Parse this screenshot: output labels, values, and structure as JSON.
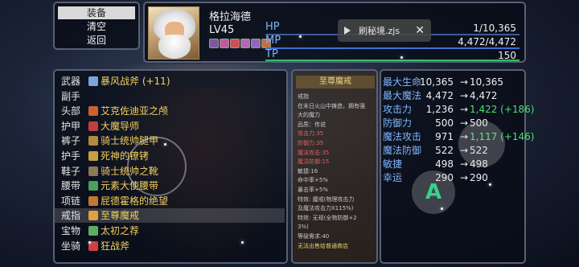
{
  "menu": {
    "items": [
      {
        "label": "装备",
        "active": true
      },
      {
        "label": "清空",
        "active": false
      },
      {
        "label": "返回",
        "active": false
      }
    ]
  },
  "character": {
    "name": "格拉海德",
    "level": "LV45",
    "buffs": [
      "buff-1",
      "buff-2",
      "buff-3",
      "buff-4",
      "buff-5",
      "buff-6"
    ],
    "bars": [
      {
        "label": "HP",
        "value": "1/10,365",
        "color": "#3e5a9e",
        "fill": 0.0001
      },
      {
        "label": "MP",
        "value": "4,472/4,472",
        "color": "#3f6fd6",
        "fill": 1
      },
      {
        "label": "TP",
        "value": "150",
        "color": "#2fbf6a",
        "fill": 1
      }
    ]
  },
  "toast": {
    "text": "刷秘境.zjs",
    "close": "✕"
  },
  "equipment": [
    {
      "slot": "武器",
      "name": "暴风战斧 (+11)",
      "icon_color": "#7aa6e0"
    },
    {
      "slot": "副手",
      "name": "",
      "icon_color": ""
    },
    {
      "slot": "头部",
      "name": "艾克佐迪亚之颅",
      "icon_color": "#d06030"
    },
    {
      "slot": "护甲",
      "name": "大魔导师",
      "icon_color": "#c04040"
    },
    {
      "slot": "裤子",
      "name": "骑士统帅腿甲",
      "icon_color": "#b08a40"
    },
    {
      "slot": "护手",
      "name": "死神的镣铐",
      "icon_color": "#c8a040"
    },
    {
      "slot": "鞋子",
      "name": "骑士统帅之靴",
      "icon_color": "#8a7a55"
    },
    {
      "slot": "腰带",
      "name": "元素大使腰带",
      "icon_color": "#4aa060"
    },
    {
      "slot": "项链",
      "name": "屁德霍格的绝望",
      "icon_color": "#c07a30"
    },
    {
      "slot": "戒指",
      "name": "至尊魔戒",
      "icon_color": "#e0a040"
    },
    {
      "slot": "宝物",
      "name": "太初之荐",
      "icon_color": "#5ab060"
    },
    {
      "slot": "坐骑",
      "name": "狂战斧",
      "icon_color": "#d04040"
    }
  ],
  "detail": {
    "title": "至尊魔戒",
    "lines": [
      {
        "text": "戒指",
        "style": "grey"
      },
      {
        "text": "在末日火山中铸造，拥有强",
        "style": "grey"
      },
      {
        "text": "大的魔力",
        "style": "grey"
      },
      {
        "text": "品质：传说",
        "style": "grey"
      },
      {
        "text": "攻击力:35",
        "style": "red"
      },
      {
        "text": "防御力:35",
        "style": "red"
      },
      {
        "text": "魔法攻击:35",
        "style": "red"
      },
      {
        "text": "魔法防御:15",
        "style": "red"
      },
      {
        "text": "敏捷:16",
        "style": "grey"
      },
      {
        "text": "命中率+5%",
        "style": "grey"
      },
      {
        "text": "暴击率+5%",
        "style": "grey"
      },
      {
        "text": "特效: 魔戒(物理攻击力",
        "style": "grey"
      },
      {
        "text": "及魔法攻击力X115%)",
        "style": "grey"
      },
      {
        "text": "特效: 无视(全物防御+2",
        "style": "grey"
      },
      {
        "text": "3%)",
        "style": "grey"
      },
      {
        "text": "等级需求:40",
        "style": "grey"
      },
      {
        "text": "无法出售给普通商店",
        "style": "yellow"
      }
    ]
  },
  "stats": [
    {
      "label": "最大生命",
      "base": "10,365",
      "arrow": "→",
      "new": "10,365",
      "up": false
    },
    {
      "label": "最大魔法",
      "base": "4,472",
      "arrow": "→",
      "new": "4,472",
      "up": false
    },
    {
      "label": "攻击力",
      "base": "1,236",
      "arrow": "→",
      "new": "1,422 (+186)",
      "up": true
    },
    {
      "label": "防御力",
      "base": "500",
      "arrow": "→",
      "new": "500",
      "up": false
    },
    {
      "label": "魔法攻击",
      "base": "971",
      "arrow": "→",
      "new": "1,117 (+146)",
      "up": true
    },
    {
      "label": "魔法防御",
      "base": "522",
      "arrow": "→",
      "new": "522",
      "up": false
    },
    {
      "label": "敏捷",
      "base": "498",
      "arrow": "→",
      "new": "498",
      "up": false
    },
    {
      "label": "幸运",
      "base": "290",
      "arrow": "→",
      "new": "290",
      "up": false
    }
  ],
  "controls": {
    "action_label": "A"
  }
}
